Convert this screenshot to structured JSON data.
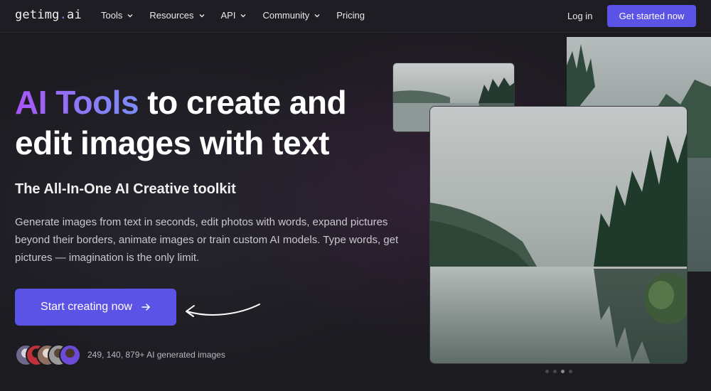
{
  "nav": {
    "logo_main": "getimg",
    "logo_dot": ".",
    "logo_suffix": "ai",
    "links": [
      {
        "label": "Tools",
        "dropdown": true
      },
      {
        "label": "Resources",
        "dropdown": true
      },
      {
        "label": "API",
        "dropdown": true
      },
      {
        "label": "Community",
        "dropdown": true
      },
      {
        "label": "Pricing",
        "dropdown": false
      }
    ],
    "login_label": "Log in",
    "cta_label": "Get started now"
  },
  "hero": {
    "title_highlight": "AI Tools",
    "title_rest_1": " to create and",
    "title_rest_2": "edit images with text",
    "subtitle": "The All-In-One AI Creative toolkit",
    "description": "Generate images from text in seconds, edit photos with words, expand pictures beyond their borders, animate images or train custom AI models. Type words, get pictures — imagination is the only limit.",
    "cta_label": "Start creating now",
    "cta_icon": "arrow-right-icon",
    "stat_text": "249, 140, 879+ AI generated images"
  },
  "carousel": {
    "active_index": 2,
    "count": 4
  },
  "colors": {
    "accent": "#5b53e6",
    "gradient_start": "#a855f7",
    "gradient_end": "#7c8cf8",
    "background": "#1c1b20"
  }
}
